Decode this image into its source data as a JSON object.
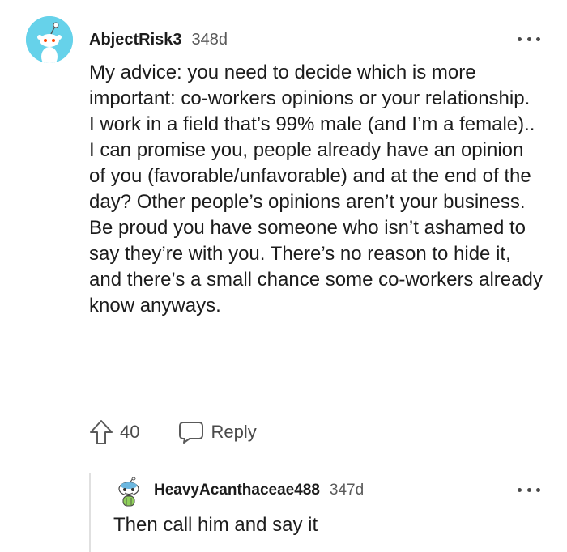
{
  "comment": {
    "username": "AbjectRisk3",
    "age": "348d",
    "paragraphs": [
      "My advice: you need to decide which is more important: co-workers opinions or your relationship.",
      "I work in a field that’s 99% male (and I’m a female).. I can promise you, people already have an opinion of you (favorable/unfavorable) and at the end of the day? Other people’s opinions aren’t your business.",
      "Be proud you have someone who isn’t ashamed to say they’re with you. There’s no reason to hide it, and there’s a small chance some co-workers already know anyways."
    ],
    "votes": "40",
    "reply_label": "Reply",
    "avatar_color": "#66d2ea"
  },
  "reply": {
    "username": "HeavyAcanthaceae488",
    "age": "347d",
    "text": "Then call him and say it"
  },
  "icons": {
    "upvote": "upvote-arrow-icon",
    "reply": "speech-bubble-icon",
    "more": "more-options-icon"
  }
}
